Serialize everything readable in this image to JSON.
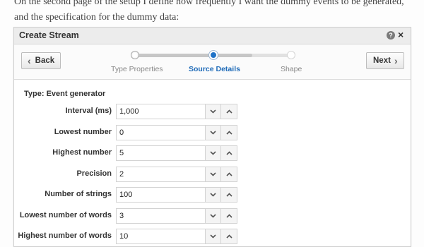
{
  "intro_text": "On the second page of the setup I define how frequently I want the dummy events to be generated, and the specification for the dummy data:",
  "dialog": {
    "title": "Create Stream",
    "help_glyph": "?",
    "close_glyph": "×"
  },
  "train": {
    "back_label": "Back",
    "next_label": "Next",
    "stops": [
      {
        "label": "Type Properties",
        "state": "visited"
      },
      {
        "label": "Source Details",
        "state": "current"
      },
      {
        "label": "Shape",
        "state": "pending"
      }
    ]
  },
  "form": {
    "type_line": "Type: Event generator",
    "fields": [
      {
        "label": "Interval (ms)",
        "value": "1,000"
      },
      {
        "label": "Lowest number",
        "value": "0"
      },
      {
        "label": "Highest number",
        "value": "5"
      },
      {
        "label": "Precision",
        "value": "2"
      },
      {
        "label": "Number of strings",
        "value": "100"
      },
      {
        "label": "Lowest number of words",
        "value": "3"
      },
      {
        "label": "Highest number of words",
        "value": "10"
      }
    ]
  },
  "colors": {
    "accent": "#1f72c7",
    "current_step_text": "#1f6bb8"
  }
}
